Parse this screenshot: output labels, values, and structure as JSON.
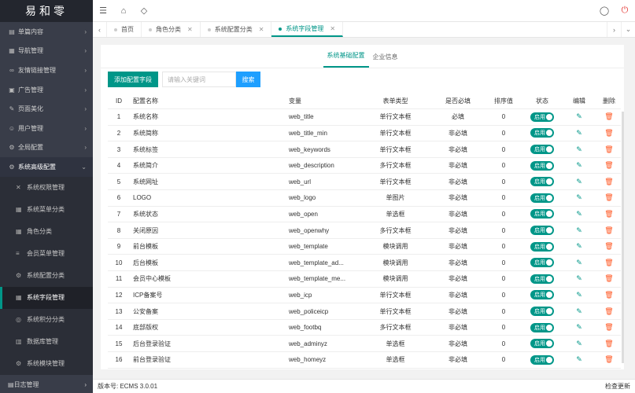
{
  "app": {
    "logo": "易和零"
  },
  "sidebar": {
    "items": [
      {
        "label": "单篇内容",
        "icon": "list-icon"
      },
      {
        "label": "导航管理",
        "icon": "grid-icon"
      },
      {
        "label": "友情链接管理",
        "icon": "link-icon"
      },
      {
        "label": "广告管理",
        "icon": "ad-icon"
      },
      {
        "label": "页面美化",
        "icon": "palette-icon"
      },
      {
        "label": "用户管理",
        "icon": "user-icon"
      },
      {
        "label": "全局配置",
        "icon": "gear-icon"
      },
      {
        "label": "系统高级配置",
        "icon": "settings-icon"
      }
    ],
    "subitems": [
      {
        "label": "系统权限管理",
        "icon": "tools-icon"
      },
      {
        "label": "系统菜单分类",
        "icon": "grid-icon"
      },
      {
        "label": "角色分类",
        "icon": "grid-icon"
      },
      {
        "label": "会员菜单管理",
        "icon": "menu-icon"
      },
      {
        "label": "系统配置分类",
        "icon": "gear-icon"
      },
      {
        "label": "系统字段管理",
        "icon": "grid-icon"
      },
      {
        "label": "系统积分分类",
        "icon": "coins-icon"
      },
      {
        "label": "数据库管理",
        "icon": "database-icon"
      },
      {
        "label": "系统模块管理",
        "icon": "gear-icon"
      }
    ],
    "bottom": {
      "label": "日志管理",
      "icon": "log-icon"
    }
  },
  "tabs": [
    {
      "label": "首页"
    },
    {
      "label": "角色分类"
    },
    {
      "label": "系统配置分类"
    },
    {
      "label": "系统字段管理"
    }
  ],
  "subtabs": [
    "系统基础配置",
    "企业信息"
  ],
  "toolbar": {
    "add_label": "添加配置字段",
    "search_placeholder": "请输入关键词",
    "search_label": "搜索"
  },
  "table": {
    "headers": [
      "ID",
      "配置名称",
      "变量",
      "表单类型",
      "是否必填",
      "排序值",
      "状态",
      "编辑",
      "删除"
    ],
    "switch_label": "启用",
    "rows": [
      {
        "id": "1",
        "name": "系统名称",
        "var": "web_title",
        "type": "单行文本框",
        "req": "必填",
        "sort": "0"
      },
      {
        "id": "2",
        "name": "系统简称",
        "var": "web_title_min",
        "type": "单行文本框",
        "req": "非必填",
        "sort": "0"
      },
      {
        "id": "3",
        "name": "系统标签",
        "var": "web_keywords",
        "type": "单行文本框",
        "req": "非必填",
        "sort": "0"
      },
      {
        "id": "4",
        "name": "系统简介",
        "var": "web_description",
        "type": "多行文本框",
        "req": "非必填",
        "sort": "0"
      },
      {
        "id": "5",
        "name": "系统网址",
        "var": "web_url",
        "type": "单行文本框",
        "req": "非必填",
        "sort": "0"
      },
      {
        "id": "6",
        "name": "LOGO",
        "var": "web_logo",
        "type": "单图片",
        "req": "非必填",
        "sort": "0"
      },
      {
        "id": "7",
        "name": "系统状态",
        "var": "web_open",
        "type": "单选框",
        "req": "非必填",
        "sort": "0"
      },
      {
        "id": "8",
        "name": "关闭原因",
        "var": "web_openwhy",
        "type": "多行文本框",
        "req": "非必填",
        "sort": "0"
      },
      {
        "id": "9",
        "name": "前台模板",
        "var": "web_template",
        "type": "模块调用",
        "req": "非必填",
        "sort": "0"
      },
      {
        "id": "10",
        "name": "后台模板",
        "var": "web_template_ad...",
        "type": "模块调用",
        "req": "非必填",
        "sort": "0"
      },
      {
        "id": "11",
        "name": "会员中心模板",
        "var": "web_template_me...",
        "type": "模块调用",
        "req": "非必填",
        "sort": "0"
      },
      {
        "id": "12",
        "name": "ICP备案号",
        "var": "web_icp",
        "type": "单行文本框",
        "req": "非必填",
        "sort": "0"
      },
      {
        "id": "13",
        "name": "公安备案",
        "var": "web_policeicp",
        "type": "单行文本框",
        "req": "非必填",
        "sort": "0"
      },
      {
        "id": "14",
        "name": "底部版权",
        "var": "web_footbq",
        "type": "多行文本框",
        "req": "非必填",
        "sort": "0"
      },
      {
        "id": "15",
        "name": "后台登录验证",
        "var": "web_adminyz",
        "type": "单选框",
        "req": "非必填",
        "sort": "0"
      },
      {
        "id": "16",
        "name": "前台登录验证",
        "var": "web_homeyz",
        "type": "单选框",
        "req": "非必填",
        "sort": "0"
      }
    ]
  },
  "footer": {
    "version": "版本号: ECMS 3.0.01",
    "update": "检查更新"
  },
  "colors": {
    "accent": "#009688",
    "search": "#1e9fff",
    "delete": "#ff5722",
    "sidebar": "#393d49"
  }
}
